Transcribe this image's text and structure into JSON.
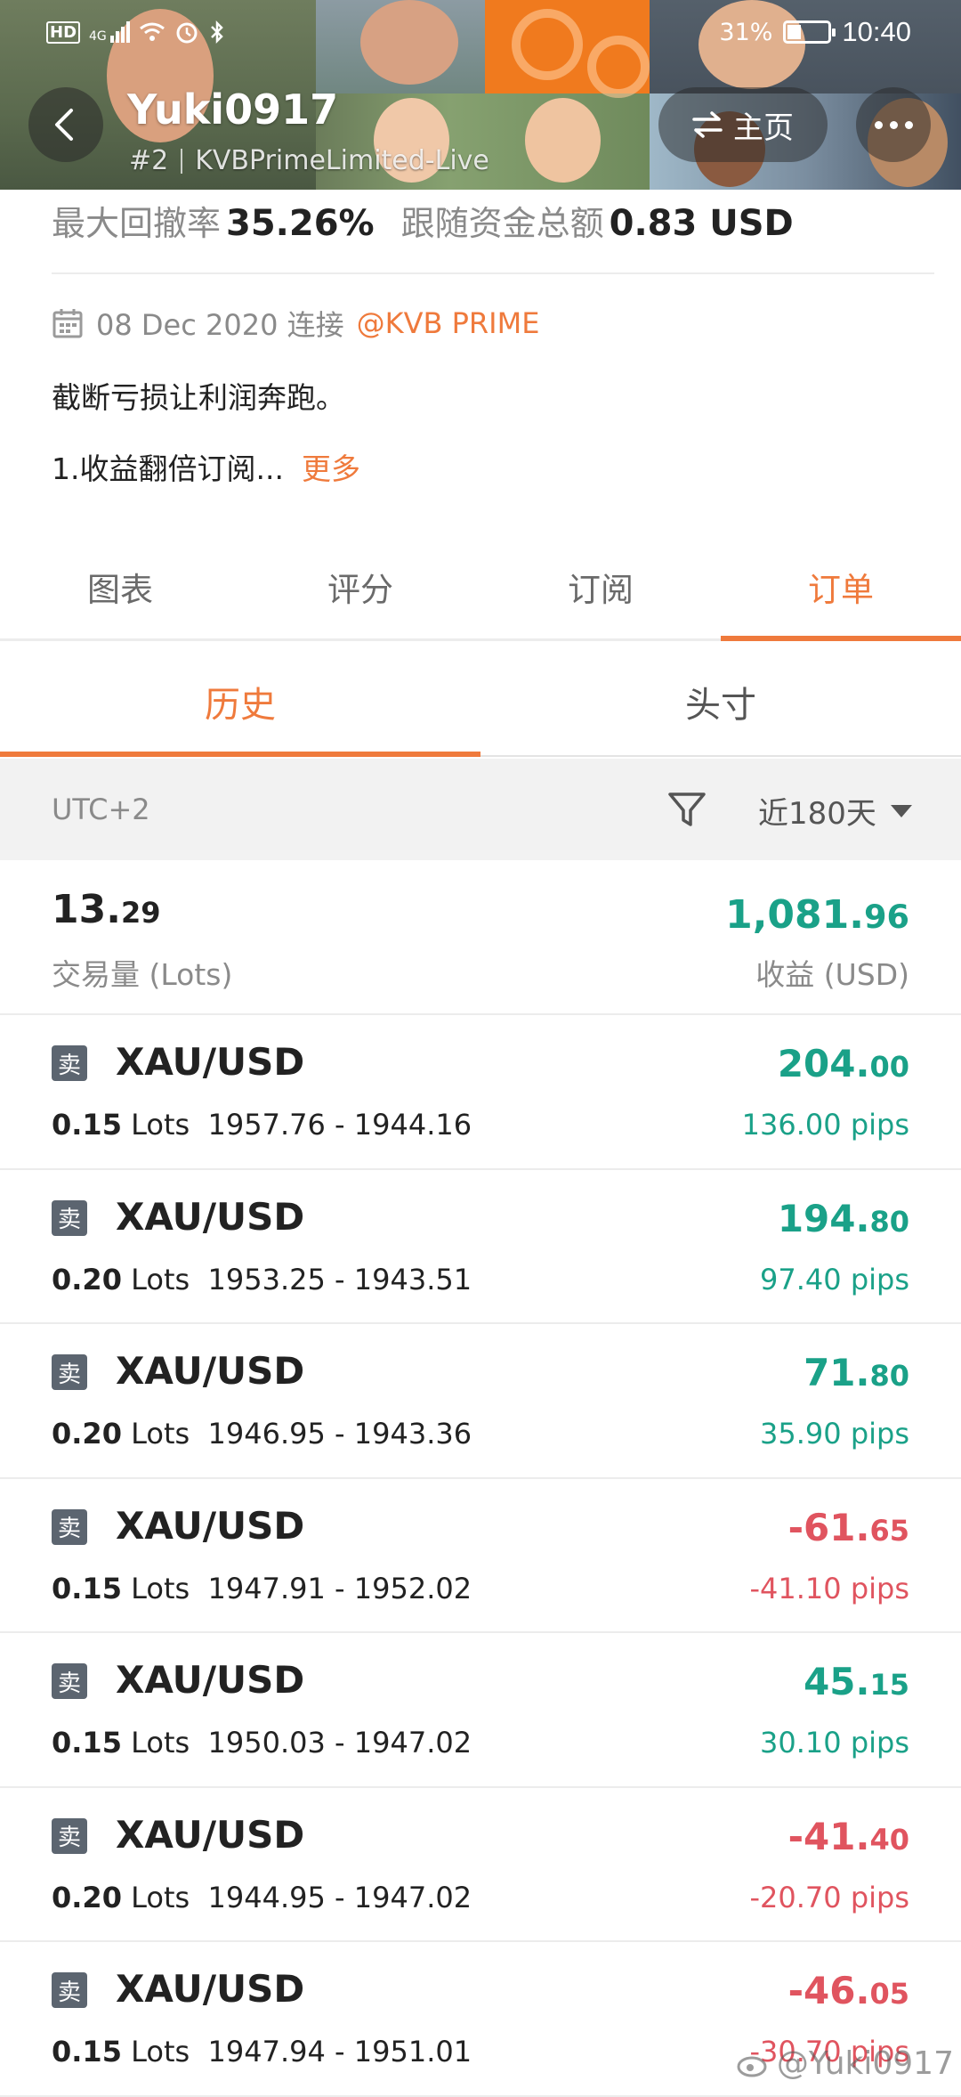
{
  "status_bar": {
    "left_icons": [
      "hd-icon",
      "signal-4g-icon",
      "wifi-icon",
      "alarm-icon",
      "bluetooth-icon"
    ],
    "network": "4G",
    "battery": "31%",
    "battery_level": 0.31,
    "time": "10:40"
  },
  "header": {
    "username": "Yuki0917",
    "rank": "#2",
    "account": "KVBPrimeLimited-Live",
    "home_label": "主页"
  },
  "stats": {
    "drawdown_label": "最大回撤率",
    "drawdown_value": "35.26%",
    "funds_label": "跟随资金总额",
    "funds_value": "0.83 USD"
  },
  "profile": {
    "join_date": "08 Dec 2020 连接",
    "broker": "@KVB PRIME",
    "bio_line1": "截断亏损让利润奔跑。",
    "bio_line2": "1.收益翻倍订阅...",
    "more_label": "更多"
  },
  "main_tabs": [
    {
      "label": "图表",
      "active": false
    },
    {
      "label": "评分",
      "active": false
    },
    {
      "label": "订阅",
      "active": false
    },
    {
      "label": "订单",
      "active": true
    }
  ],
  "sub_tabs": [
    {
      "label": "历史",
      "active": true
    },
    {
      "label": "头寸",
      "active": false
    }
  ],
  "filter": {
    "timezone": "UTC+2",
    "period": "近180天"
  },
  "summary": {
    "lots_int": "13.",
    "lots_dec": "29",
    "lots_label": "交易量 (Lots)",
    "profit_int": "1,081.",
    "profit_dec": "96",
    "profit_label": "收益 (USD)"
  },
  "trades": [
    {
      "side": "卖",
      "symbol": "XAU/USD",
      "lots": "0.15",
      "lots_unit": "Lots",
      "prices": "1957.76 - 1944.16",
      "amt_int": "204.",
      "amt_dec": "00",
      "pips": "136.00 pips",
      "positive": true
    },
    {
      "side": "卖",
      "symbol": "XAU/USD",
      "lots": "0.20",
      "lots_unit": "Lots",
      "prices": "1953.25 - 1943.51",
      "amt_int": "194.",
      "amt_dec": "80",
      "pips": "97.40 pips",
      "positive": true
    },
    {
      "side": "卖",
      "symbol": "XAU/USD",
      "lots": "0.20",
      "lots_unit": "Lots",
      "prices": "1946.95 - 1943.36",
      "amt_int": "71.",
      "amt_dec": "80",
      "pips": "35.90 pips",
      "positive": true
    },
    {
      "side": "卖",
      "symbol": "XAU/USD",
      "lots": "0.15",
      "lots_unit": "Lots",
      "prices": "1947.91 - 1952.02",
      "amt_int": "-61.",
      "amt_dec": "65",
      "pips": "-41.10 pips",
      "positive": false
    },
    {
      "side": "卖",
      "symbol": "XAU/USD",
      "lots": "0.15",
      "lots_unit": "Lots",
      "prices": "1950.03 - 1947.02",
      "amt_int": "45.",
      "amt_dec": "15",
      "pips": "30.10 pips",
      "positive": true
    },
    {
      "side": "卖",
      "symbol": "XAU/USD",
      "lots": "0.20",
      "lots_unit": "Lots",
      "prices": "1944.95 - 1947.02",
      "amt_int": "-41.",
      "amt_dec": "40",
      "pips": "-20.70 pips",
      "positive": false
    },
    {
      "side": "卖",
      "symbol": "XAU/USD",
      "lots": "0.15",
      "lots_unit": "Lots",
      "prices": "1947.94 - 1951.01",
      "amt_int": "-46.",
      "amt_dec": "05",
      "pips": "-30.70 pips",
      "positive": false
    }
  ],
  "watermark": "@Yuki0917",
  "colors": {
    "accent": "#ef7a3c",
    "profit": "#1aa188",
    "loss": "#e0545f"
  }
}
